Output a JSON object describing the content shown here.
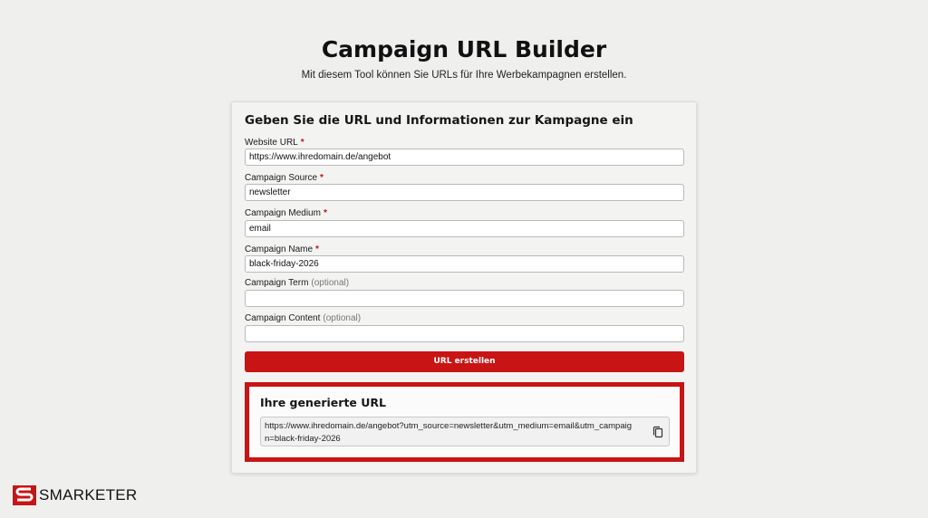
{
  "header": {
    "title": "Campaign URL Builder",
    "subtitle": "Mit diesem Tool können Sie URLs für Ihre Werbekampagnen erstellen."
  },
  "form": {
    "heading": "Geben Sie die URL und Informationen zur Kampagne ein",
    "required_marker": "*",
    "fields": [
      {
        "label": "Website URL",
        "required": true,
        "value": "https://www.ihredomain.de/angebot"
      },
      {
        "label": "Campaign Source",
        "required": true,
        "value": "newsletter"
      },
      {
        "label": "Campaign Medium",
        "required": true,
        "value": "email"
      },
      {
        "label": "Campaign Name",
        "required": true,
        "value": "black-friday-2026"
      },
      {
        "label": "Campaign Term",
        "optional_note": "(optional)",
        "value": ""
      },
      {
        "label": "Campaign Content",
        "optional_note": "(optional)",
        "value": ""
      }
    ],
    "submit_label": "URL erstellen"
  },
  "result": {
    "heading": "Ihre generierte URL",
    "url": "https://www.ihredomain.de/angebot?utm_source=newsletter&utm_medium=email&utm_campaign=black-friday-2026",
    "copy_icon": "copy-icon"
  },
  "brand": {
    "name": "SMARKETER",
    "accent_color": "#c81414"
  }
}
